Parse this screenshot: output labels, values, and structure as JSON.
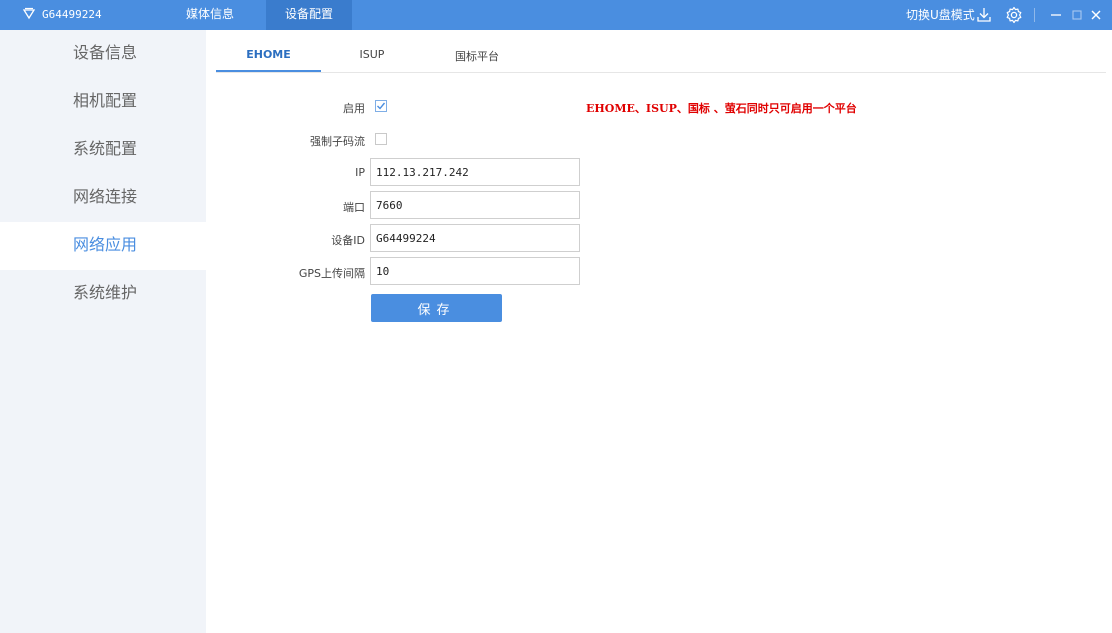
{
  "titlebar": {
    "device_id": "G64499224",
    "tabs": [
      {
        "label": "媒体信息"
      },
      {
        "label": "设备配置"
      }
    ],
    "switch_mode_label": "切换U盘模式"
  },
  "sidebar": {
    "items": [
      {
        "label": "设备信息"
      },
      {
        "label": "相机配置"
      },
      {
        "label": "系统配置"
      },
      {
        "label": "网络连接"
      },
      {
        "label": "网络应用"
      },
      {
        "label": "系统维护"
      }
    ]
  },
  "content": {
    "tabs": [
      {
        "label": "EHOME"
      },
      {
        "label": "ISUP"
      },
      {
        "label": "国标平台"
      }
    ],
    "form": {
      "enable_label": "启用",
      "enable_checked": true,
      "force_substream_label": "强制子码流",
      "force_substream_checked": false,
      "notice": "EHOME、ISUP、国标 、萤石同时只可启用一个平台",
      "ip_label": "IP",
      "ip_value": "112.13.217.242",
      "port_label": "端口",
      "port_value": "7660",
      "device_id_label": "设备ID",
      "device_id_value": "G64499224",
      "gps_interval_label": "GPS上传间隔",
      "gps_interval_value": "10",
      "save_label": "保存"
    }
  },
  "icons": {
    "logo": "app-logo-icon",
    "download": "download-icon",
    "settings": "gear-icon",
    "minimize": "minimize-icon",
    "maximize": "maximize-icon",
    "close": "close-icon"
  },
  "colors": {
    "accent": "#4a8ee0",
    "sidebar_bg": "#f1f4f9",
    "notice": "#e00000"
  }
}
